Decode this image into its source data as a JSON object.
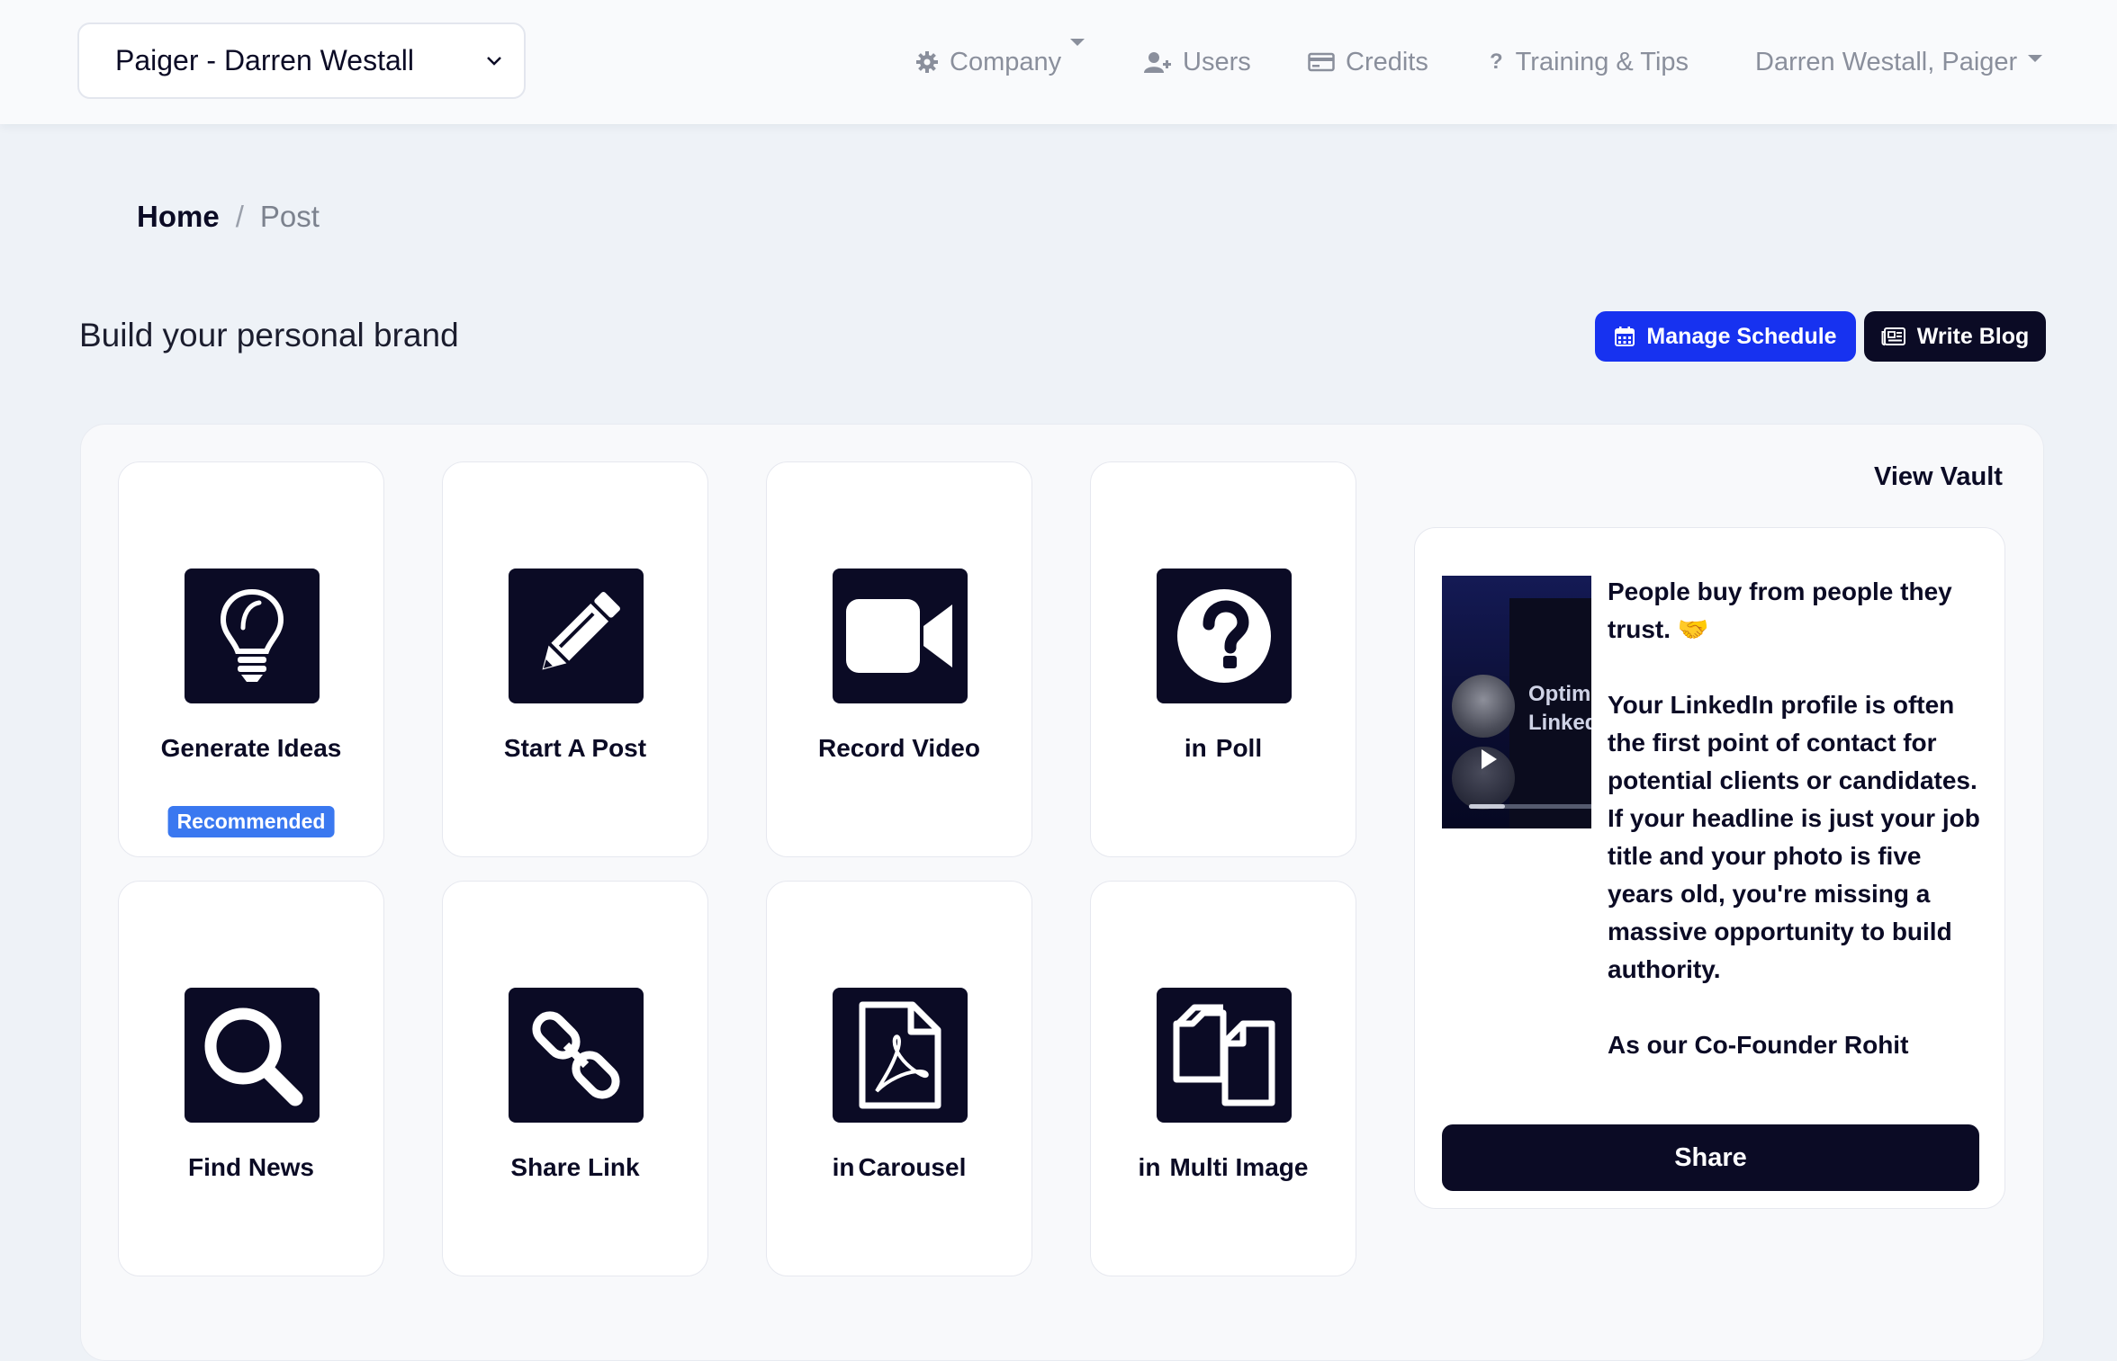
{
  "header": {
    "org_select_value": "Paiger - Darren Westall",
    "nav": {
      "company": "Company",
      "users": "Users",
      "credits": "Credits",
      "training": "Training & Tips",
      "account": "Darren Westall, Paiger"
    }
  },
  "breadcrumb": {
    "home": "Home",
    "separator": "/",
    "current": "Post"
  },
  "page": {
    "title": "Build your personal brand",
    "manage_schedule": "Manage Schedule",
    "write_blog": "Write Blog"
  },
  "tiles": [
    {
      "label": "Generate Ideas",
      "icon": "lightbulb-icon",
      "badge": "Recommended"
    },
    {
      "label": "Start A Post",
      "icon": "pencil-icon"
    },
    {
      "label": "Record Video",
      "icon": "video-camera-icon"
    },
    {
      "label": "Poll",
      "icon": "question-circle-icon",
      "prefix": "in"
    },
    {
      "label": "Find News",
      "icon": "magnifier-icon"
    },
    {
      "label": "Share Link",
      "icon": "link-icon"
    },
    {
      "label": "Carousel",
      "icon": "pdf-file-icon",
      "prefix": "in"
    },
    {
      "label": "Multi Image",
      "icon": "copy-files-icon",
      "prefix": "in"
    }
  ],
  "vault": {
    "view_vault": "View Vault",
    "thumb_text_1": "Optim",
    "thumb_text_2": "Linked",
    "post_paragraphs": [
      "People buy from people they trust. 🤝",
      "Your LinkedIn profile is often the first point of contact for potential clients or candidates. If your headline is just your job title and your photo is five years old, you're missing a massive opportunity to build authority.",
      "As our Co-Founder Rohit"
    ],
    "share": "Share"
  },
  "colors": {
    "navy": "#0b0b25",
    "primary_blue": "#1732f0",
    "badge_blue": "#3a78f0",
    "page_bg": "#eef2f7"
  }
}
